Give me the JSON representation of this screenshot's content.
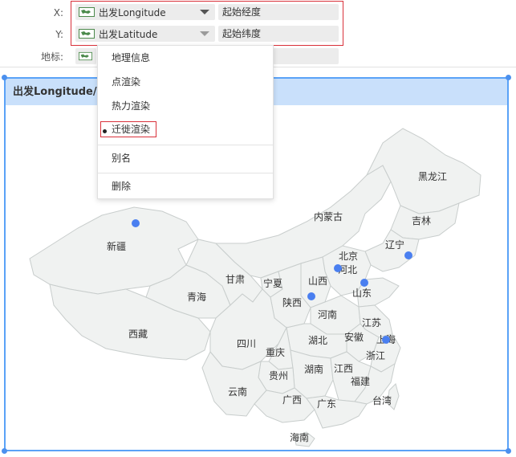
{
  "fields": {
    "x": {
      "label": "X:",
      "field": "出发Longitude",
      "alias": "起始经度"
    },
    "y": {
      "label": "Y:",
      "field": "出发Latitude",
      "alias": "起始纬度"
    },
    "geo": {
      "label": "地标:"
    }
  },
  "chart": {
    "header": "出发Longitude/出",
    "regions": [
      "黑龙江",
      "吉林",
      "辽宁",
      "内蒙古",
      "北京",
      "河北",
      "山西",
      "山东",
      "宁夏",
      "甘肃",
      "新疆",
      "青海",
      "陕西",
      "河南",
      "江苏",
      "安徽",
      "上海",
      "湖北",
      "浙江",
      "西藏",
      "四川",
      "重庆",
      "湖南",
      "江西",
      "贵州",
      "福建",
      "云南",
      "广西",
      "广东",
      "台湾",
      "海南"
    ],
    "points_color": "#4a7ff0"
  },
  "menu": {
    "items": [
      "地理信息",
      "点渲染",
      "热力渲染",
      "迁徙渲染",
      "别名",
      "删除"
    ],
    "selected": "迁徙渲染"
  },
  "colors": {
    "accent": "#5aa2f7",
    "header": "#c9e0fb",
    "highlight": "#d9313a",
    "map_fill": "#f0f2f1",
    "map_stroke": "#c8cdcc"
  }
}
